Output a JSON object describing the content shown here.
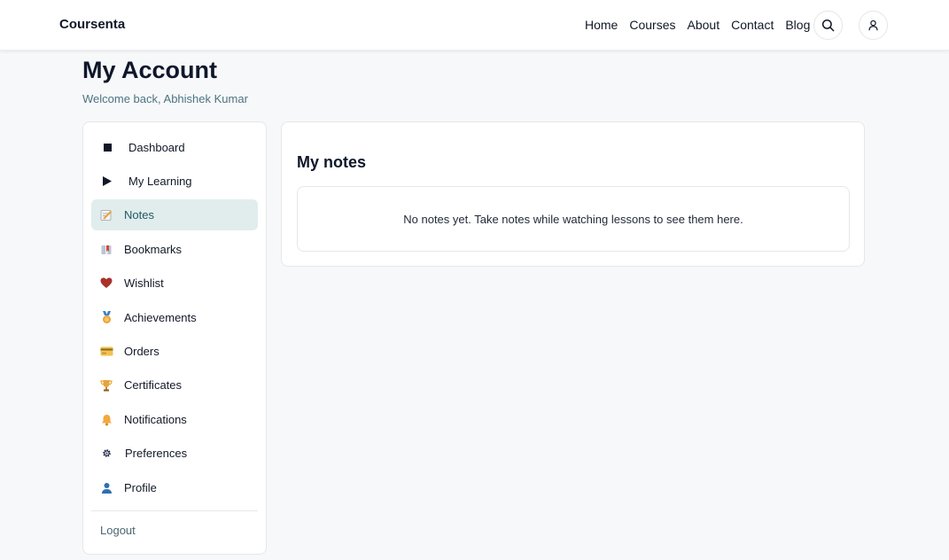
{
  "header": {
    "brand": "Coursenta",
    "nav": [
      {
        "label": "Home"
      },
      {
        "label": "Courses"
      },
      {
        "label": "About"
      },
      {
        "label": "Contact"
      },
      {
        "label": "Blog"
      }
    ],
    "search_icon": "search-icon",
    "user_icon": "user-icon"
  },
  "page": {
    "title": "My Account",
    "welcome": "Welcome back, Abhishek Kumar"
  },
  "sidebar": {
    "items": [
      {
        "label": "Dashboard",
        "icon": "square-icon"
      },
      {
        "label": "My Learning",
        "icon": "play-icon"
      },
      {
        "label": "Notes",
        "icon": "memo-icon",
        "active": true
      },
      {
        "label": "Bookmarks",
        "icon": "bookmark-icon"
      },
      {
        "label": "Wishlist",
        "icon": "heart-icon"
      },
      {
        "label": "Achievements",
        "icon": "medal-icon"
      },
      {
        "label": "Orders",
        "icon": "credit-card-icon"
      },
      {
        "label": "Certificates",
        "icon": "trophy-icon"
      },
      {
        "label": "Notifications",
        "icon": "bell-icon"
      },
      {
        "label": "Preferences",
        "icon": "gear-icon"
      },
      {
        "label": "Profile",
        "icon": "person-icon"
      }
    ],
    "logout": "Logout"
  },
  "notes": {
    "title": "My notes",
    "empty_message": "No notes yet. Take notes while watching lessons to see them here."
  },
  "colors": {
    "accent_bg": "#e1eded",
    "accent_text": "#1f5a66",
    "page_bg": "#f7f8fa"
  }
}
